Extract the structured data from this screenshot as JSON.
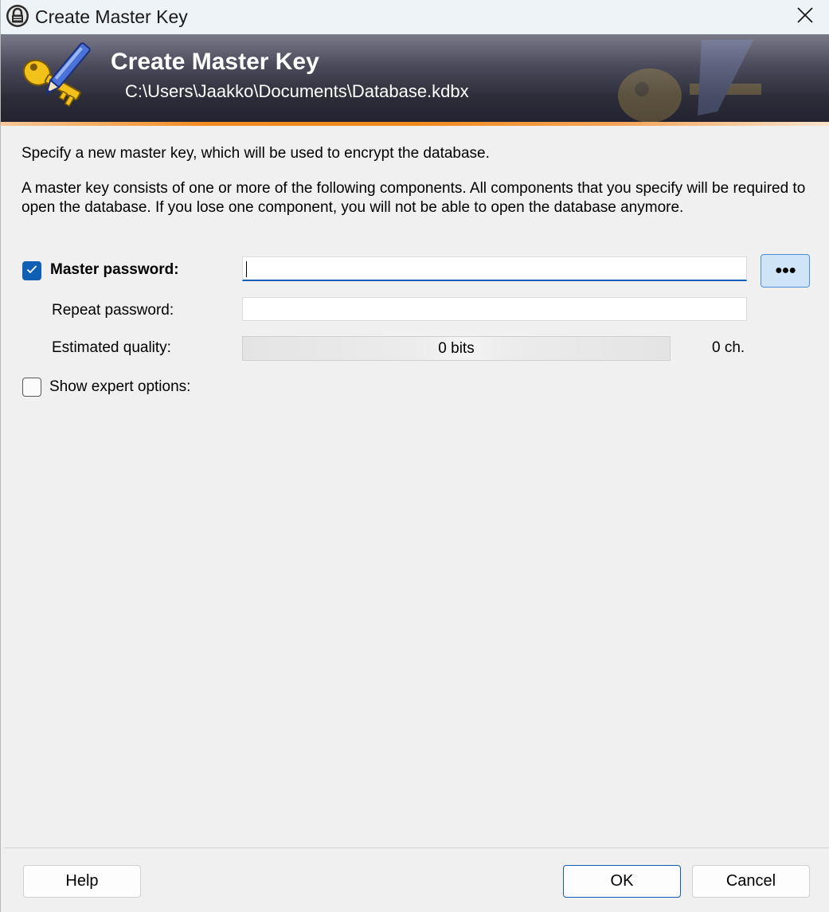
{
  "window": {
    "title": "Create Master Key"
  },
  "banner": {
    "title": "Create Master Key",
    "path": "C:\\Users\\Jaakko\\Documents\\Database.kdbx"
  },
  "intro": {
    "line1": "Specify a new master key, which will be used to encrypt the database.",
    "line2": "A master key consists of one or more of the following components. All components that you specify will be required to open the database. If you lose one component, you will not be able to open the database anymore."
  },
  "master_password": {
    "checked": true,
    "label": "Master password:",
    "value": "",
    "toggle_label": "●●●"
  },
  "repeat_password": {
    "label": "Repeat password:",
    "value": ""
  },
  "quality": {
    "label": "Estimated quality:",
    "bits_text": "0 bits",
    "chars_text": "0 ch.",
    "fill_fraction": 0
  },
  "expert_options": {
    "checked": false,
    "label": "Show expert options:"
  },
  "buttons": {
    "help": "Help",
    "ok": "OK",
    "cancel": "Cancel"
  },
  "colors": {
    "accent": "#0f5fb4",
    "banner_stripe": "#f28b1e"
  },
  "icons": [
    "keepass-lock-icon",
    "close-icon",
    "key-pen-icon",
    "checkmark-icon"
  ]
}
